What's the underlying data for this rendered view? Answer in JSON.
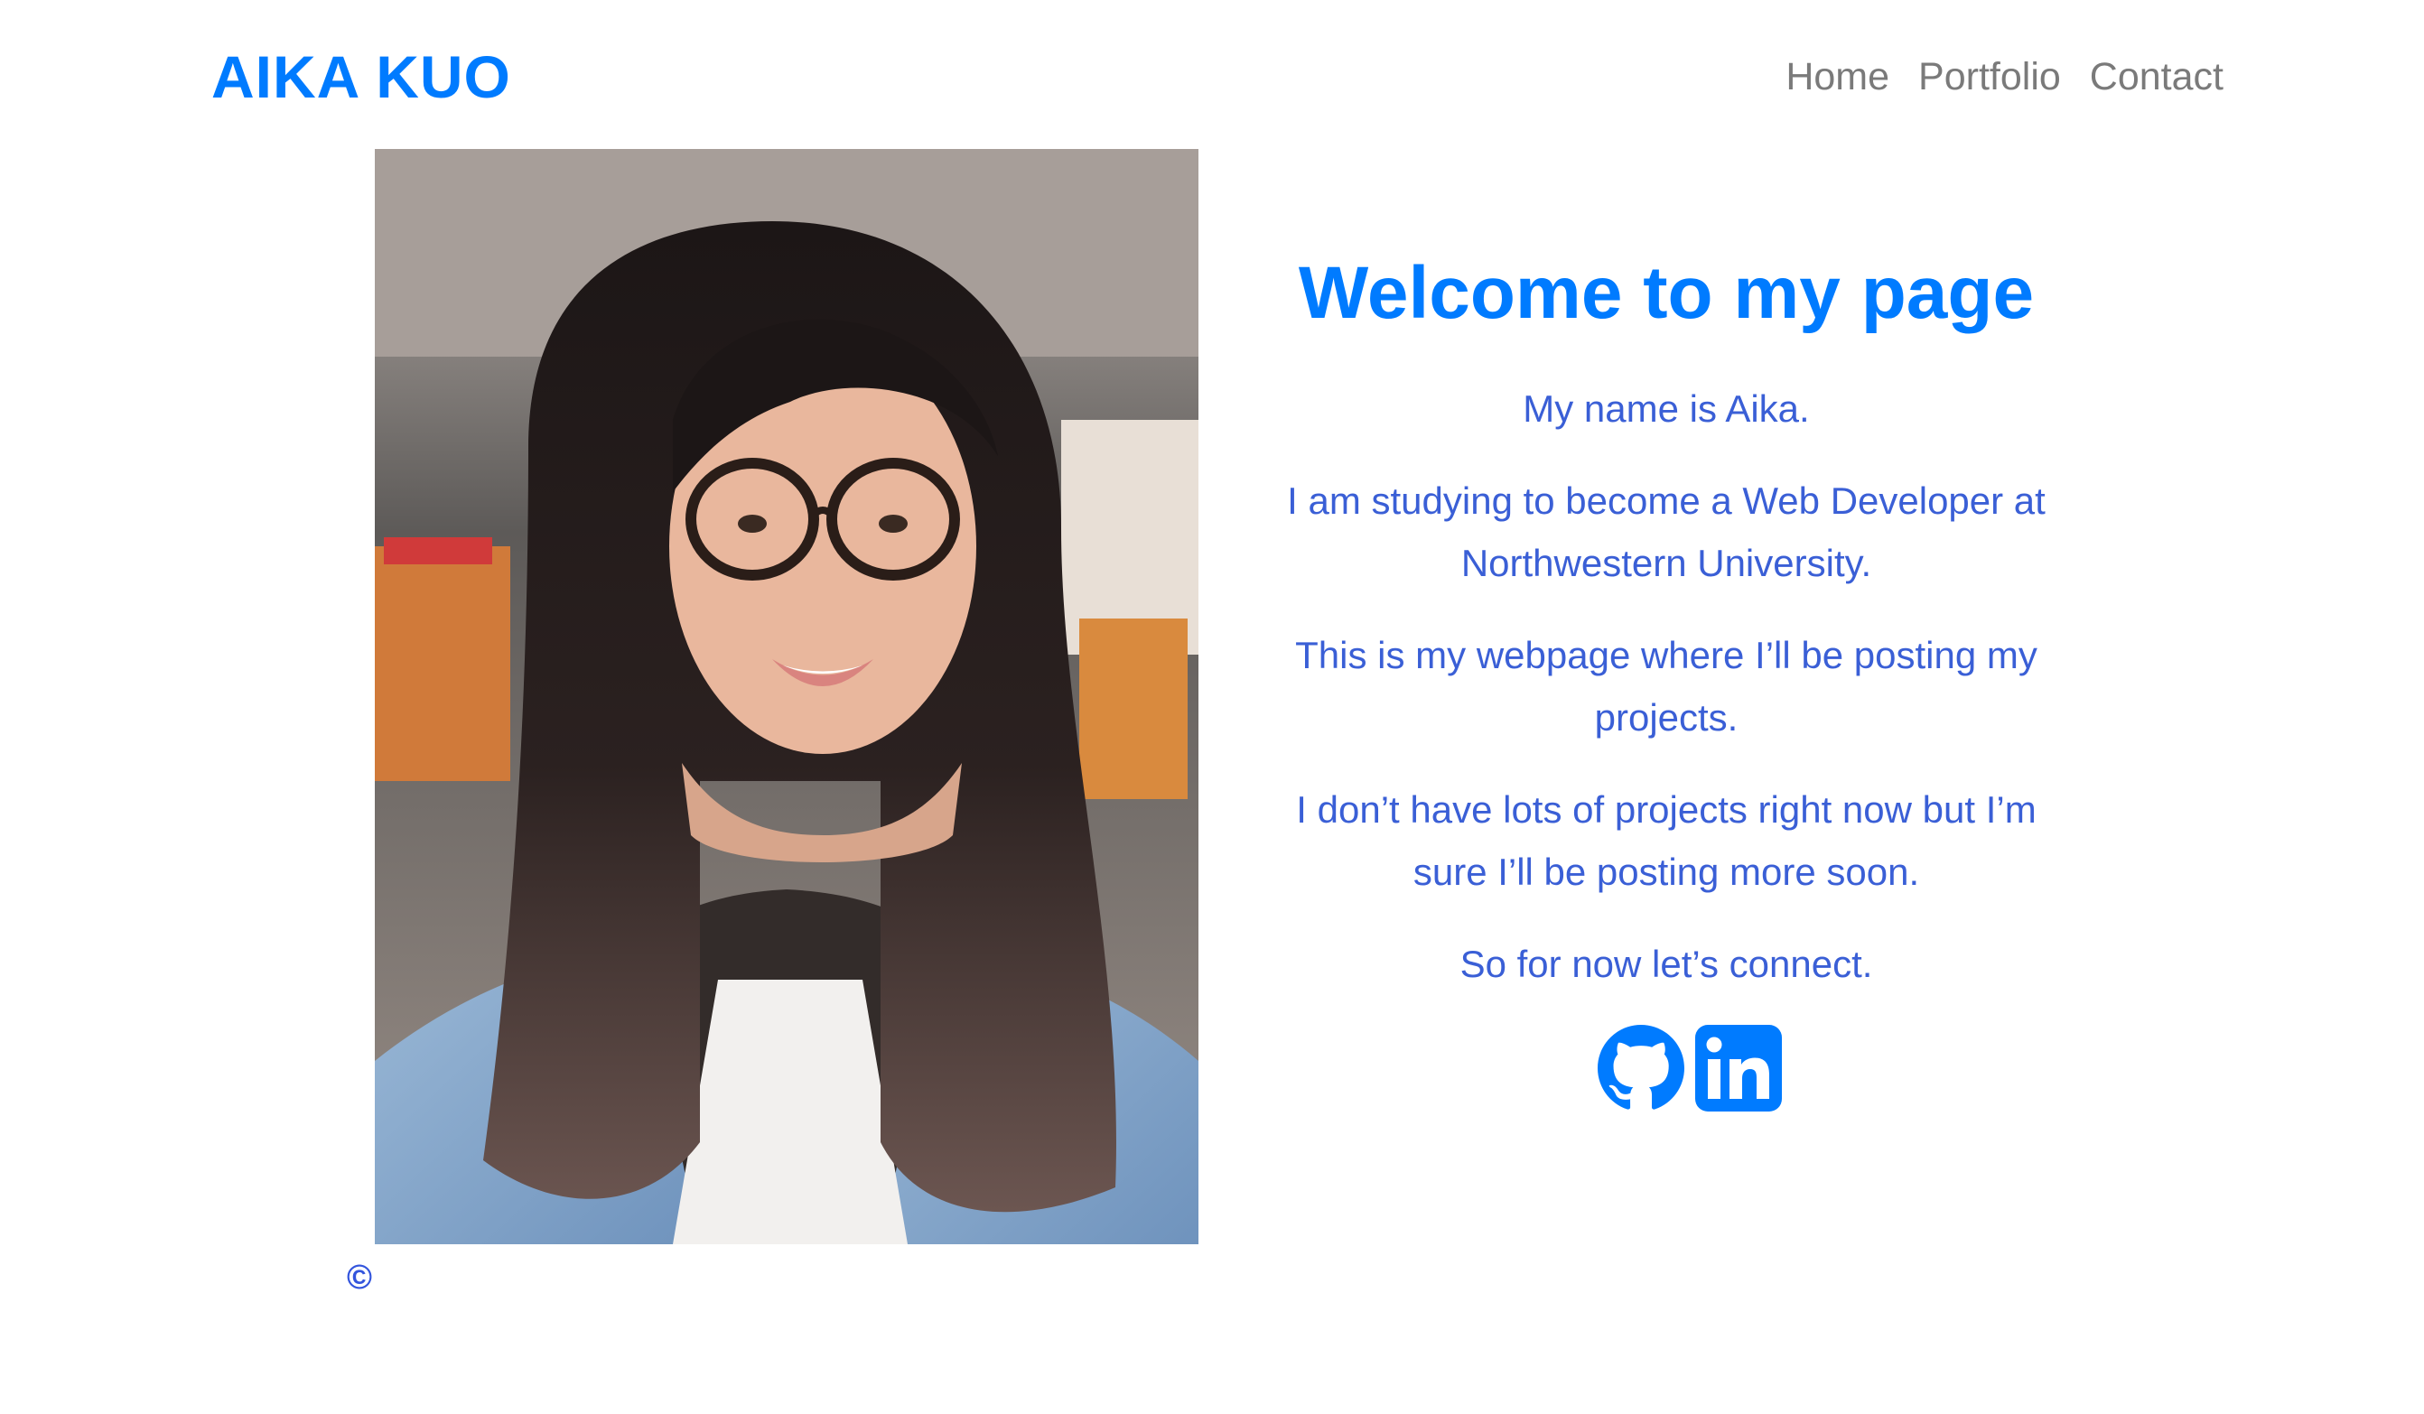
{
  "header": {
    "brand": "AIKA KUO",
    "nav": [
      "Home",
      "Portfolio",
      "Contact"
    ]
  },
  "hero": {
    "photo_alt": "Portrait photo of Aika",
    "heading": "Welcome to my page",
    "paragraphs": [
      "My name is Aika.",
      "I am studying to become a Web Developer at Northwestern University.",
      "This is my webpage where I’ll be posting my projects.",
      "I don’t have lots of projects right now but I’m sure I’ll be posting more soon.",
      "So for now let’s connect."
    ],
    "social_icons": [
      "github-icon",
      "linkedin-icon"
    ]
  },
  "footer": {
    "copyright": "©"
  },
  "colors": {
    "accent": "#007bff",
    "body_text": "#3a5fd6",
    "nav_text": "#7a7a7a"
  }
}
